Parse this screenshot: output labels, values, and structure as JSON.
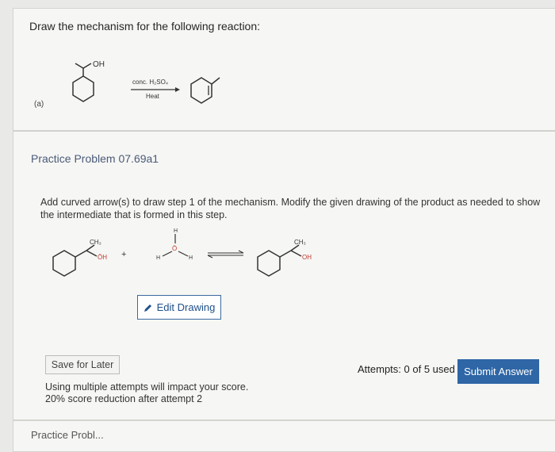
{
  "question": {
    "prompt": "Draw the mechanism for the following reaction:",
    "part_label": "(a)",
    "reactant_group": "OH",
    "reagent_line1": "conc. H₂SO₄",
    "reagent_line2": "Heat"
  },
  "practice": {
    "title": "Practice Problem 07.69a1",
    "instruction": "Add curved arrow(s) to draw step 1 of the mechanism. Modify the given drawing of the product as needed to show the intermediate that is formed in this step.",
    "left_methyl": "CH₃",
    "left_oh": "ÖH",
    "plus": "+",
    "water_h_top": "H",
    "water_o": "Ö",
    "water_h_left": "H",
    "water_h_right": "H",
    "right_methyl": "CH₃",
    "right_oh": "OH",
    "edit_label": "Edit Drawing",
    "save_label": "Save for Later",
    "note_line1": "Using multiple attempts will impact your score.",
    "note_line2": "20% score reduction after attempt 2",
    "attempts": "Attempts: 0 of 5 used",
    "submit_label": "Submit Answer"
  },
  "next_card": {
    "title": "Practice Probl..."
  },
  "colors": {
    "accent": "#2e66a6",
    "practice_title": "#4a5a78",
    "oxygen": "#c0392b"
  }
}
